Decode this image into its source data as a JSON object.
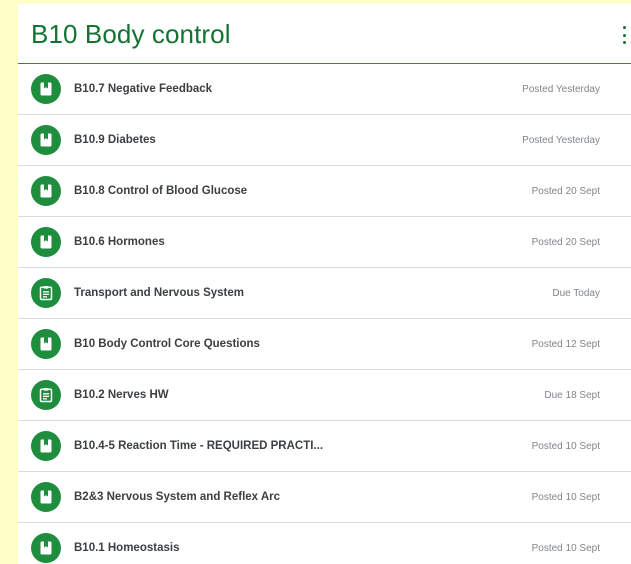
{
  "topic": {
    "title": "B10 Body control"
  },
  "items": [
    {
      "title": "B10.7 Negative Feedback",
      "status": "Posted Yesterday",
      "icon": "material-icon"
    },
    {
      "title": "B10.9 Diabetes",
      "status": "Posted Yesterday",
      "icon": "material-icon"
    },
    {
      "title": "B10.8 Control of Blood Glucose",
      "status": "Posted 20 Sept",
      "icon": "material-icon"
    },
    {
      "title": "B10.6 Hormones",
      "status": "Posted 20 Sept",
      "icon": "material-icon"
    },
    {
      "title": "Transport and Nervous System",
      "status": "Due Today",
      "icon": "assignment-icon"
    },
    {
      "title": "B10 Body Control Core Questions",
      "status": "Posted 12 Sept",
      "icon": "material-icon"
    },
    {
      "title": "B10.2 Nerves HW",
      "status": "Due 18 Sept",
      "icon": "assignment-icon"
    },
    {
      "title": "B10.4-5 Reaction Time - REQUIRED PRACTI...",
      "status": "Posted 10 Sept",
      "icon": "material-icon"
    },
    {
      "title": "B2&3 Nervous System and Reflex Arc",
      "status": "Posted 10 Sept",
      "icon": "material-icon"
    },
    {
      "title": "B10.1 Homeostasis",
      "status": "Posted 10 Sept",
      "icon": "material-icon"
    }
  ],
  "colors": {
    "page_background": "#fefec8",
    "accent": "#1e8e3e",
    "title": "#137333"
  }
}
